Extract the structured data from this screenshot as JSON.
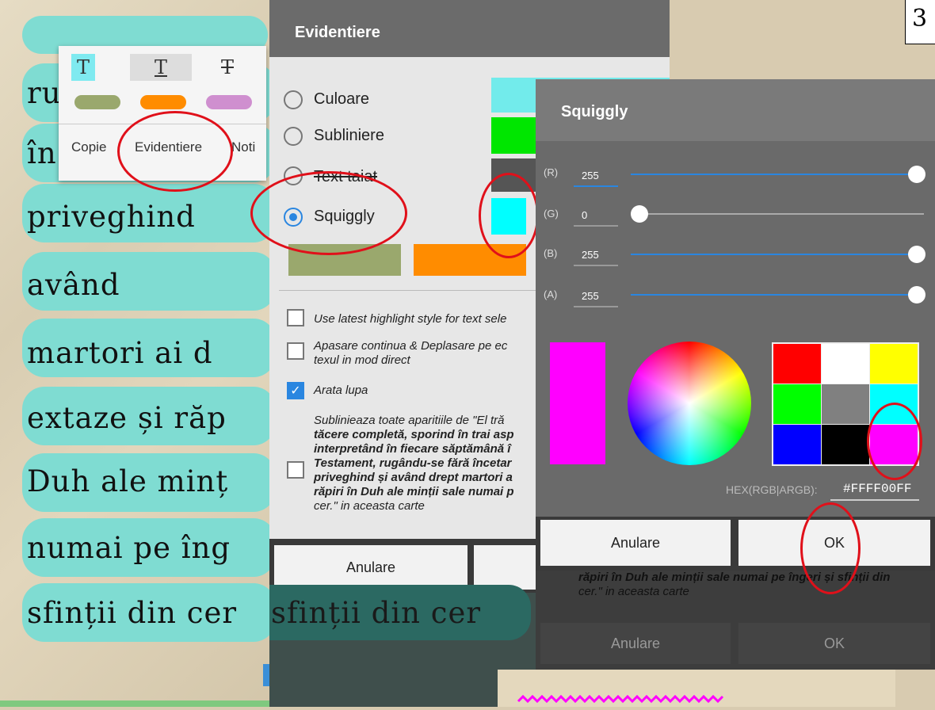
{
  "page_number": "3",
  "reader": {
    "lines": [
      "ru",
      "în",
      "priveghind",
      "având",
      "martori ai d",
      "extaze și răp",
      "Duh ale minț",
      "numai pe îng",
      "sfinții din cer"
    ],
    "popup": {
      "style_glyphs": [
        "T",
        "T",
        "T"
      ],
      "swatch_colors": [
        "#9aa86d",
        "#ff8c00",
        "#cf8fcf"
      ],
      "actions": [
        "Copie",
        "Evidentiere",
        "Noti"
      ]
    }
  },
  "highlight_dialog": {
    "title": "Evidentiere",
    "options": [
      "Culoare",
      "Subliniere",
      "Text taiat",
      "Squiggly"
    ],
    "selected": "Squiggly",
    "option_colors": [
      "#72ebeb",
      "#00e600",
      "#555555",
      "#00ffff"
    ],
    "bottom_swatch_colors": [
      "#9aa86d",
      "#ff8c00"
    ],
    "checkboxes": [
      {
        "label": "Use latest highlight style for text sele",
        "checked": false
      },
      {
        "label": "Apasare continua & Deplasare pe ec",
        "label2": "texul in mod direct",
        "checked": false
      },
      {
        "label": "Arata lupa",
        "checked": true
      }
    ],
    "note": {
      "lines": [
        "Sublinieaza toate aparitiile de \"El tră",
        "tăcere completă, sporind în trai asp",
        "interpretând în fiecare săptămână î",
        "Testament, rugându-se fără încetar",
        "priveghind și având drept martori a",
        "răpiri în Duh ale minții sale numai p",
        "cer.\" in aceasta carte"
      ]
    },
    "cancel_label": "Anulare",
    "behind_line": "sfinții din cer"
  },
  "squiggly_dialog": {
    "title": "Squiggly",
    "channels": [
      {
        "label": "(R)",
        "value": "255",
        "level": 1.0
      },
      {
        "label": "(G)",
        "value": "0",
        "level": 0.0
      },
      {
        "label": "(B)",
        "value": "255",
        "level": 1.0
      },
      {
        "label": "(A)",
        "value": "255",
        "level": 1.0
      }
    ],
    "preview_color": "#ff00ff",
    "palette": [
      "#ff0000",
      "#ffffff",
      "#ffff00",
      "#00ff00",
      "#808080",
      "#00ffff",
      "#0000ff",
      "#000000",
      "#ff00ff"
    ],
    "hex_label": "HEX(RGB|ARGB):",
    "hex_value": "#FFFF00FF",
    "cancel_label": "Anulare",
    "ok_label": "OK",
    "behind_text": [
      "răpiri în Duh ale minții sale numai pe îngeri și sfinții din",
      "cer.\" in aceasta carte"
    ],
    "behind_cancel": "Anulare",
    "behind_ok": "OK"
  }
}
